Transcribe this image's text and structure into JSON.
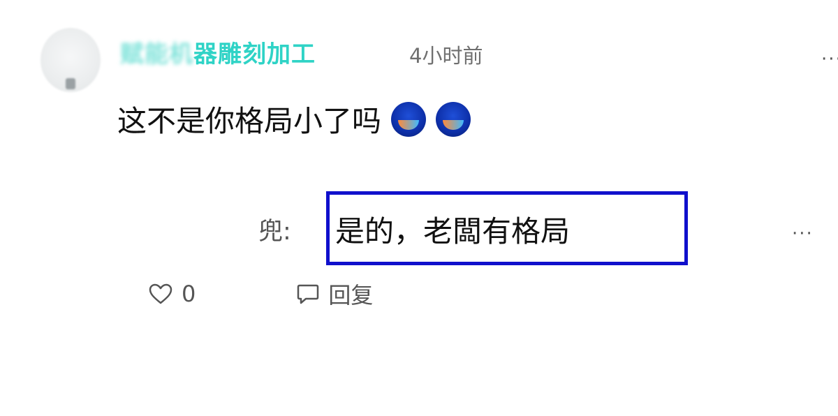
{
  "comment": {
    "username": "器雕刻加工",
    "timestamp": "4小时前",
    "text": "这不是你格局小了吗",
    "emojis": [
      "emoji-icon",
      "emoji-icon"
    ],
    "more_label": "···"
  },
  "reply": {
    "author_suffix": "兜:",
    "text": "是的，老闆有格局",
    "highlight_color": "#1010cc",
    "more_label": "···"
  },
  "actions": {
    "like_count": "0",
    "reply_label": "回复"
  },
  "colors": {
    "username": "#2fd3c6",
    "timestamp": "#6f6f6f",
    "text": "#111111"
  }
}
